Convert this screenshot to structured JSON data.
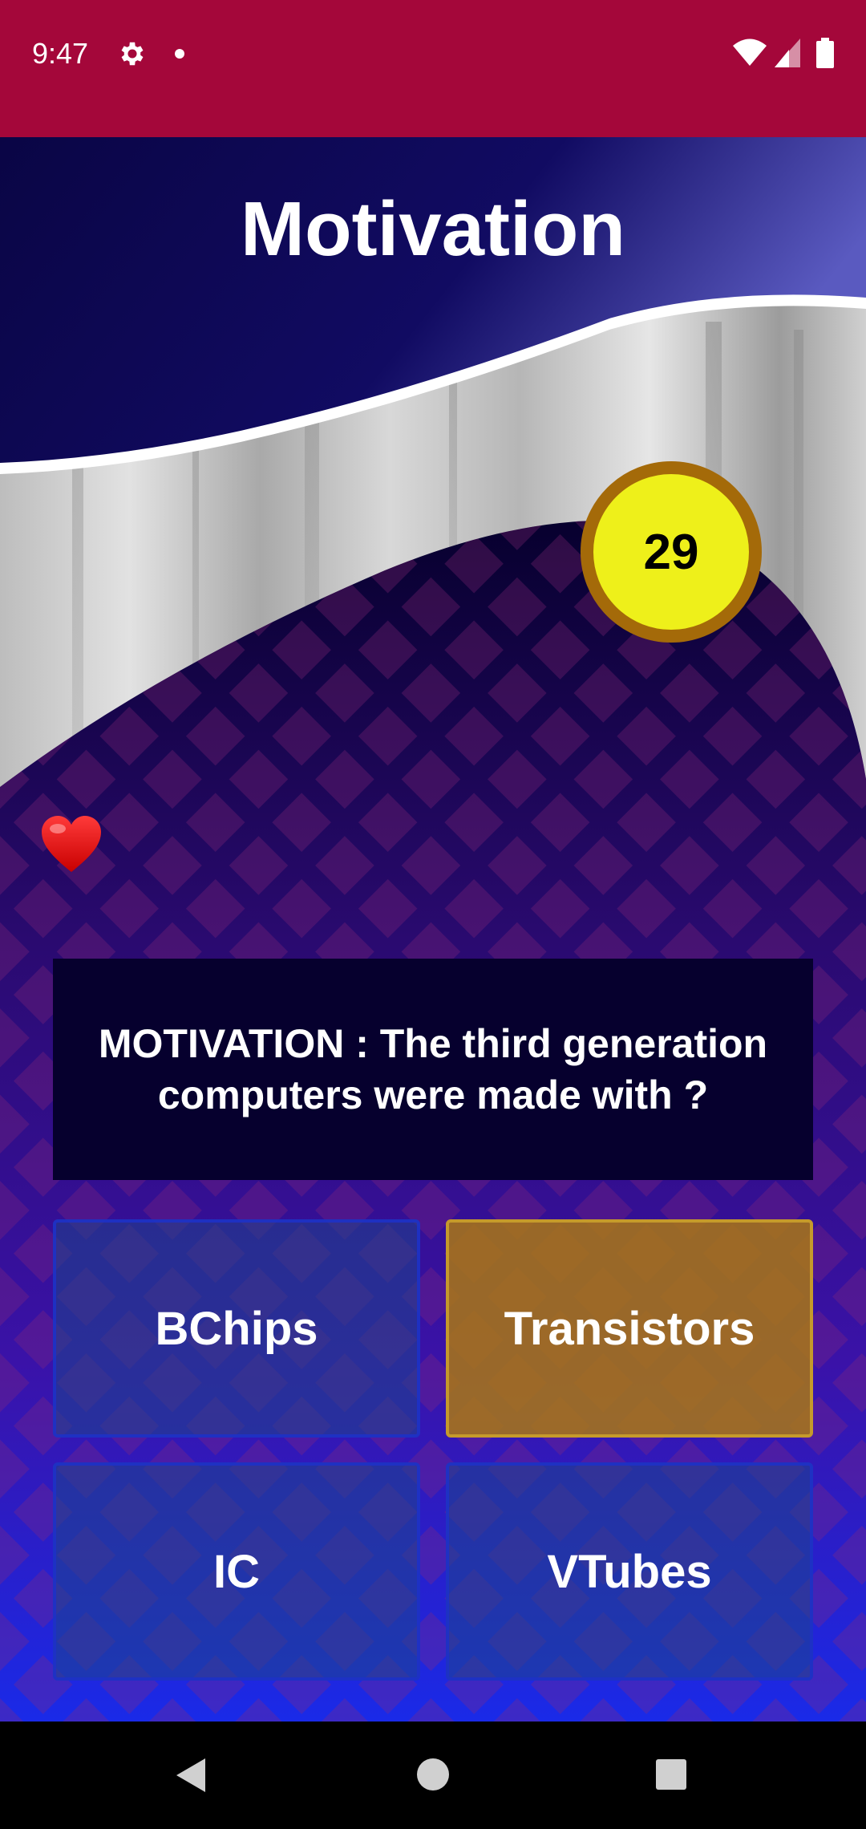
{
  "status_bar": {
    "time": "9:47",
    "icons": [
      "gear-icon",
      "notification-dot-icon",
      "wifi-icon",
      "signal-icon",
      "battery-icon"
    ],
    "background": "#a4073a"
  },
  "game": {
    "title": "Motivation",
    "timer": "29",
    "lives_icon": "heart-icon",
    "question": "MOTIVATION : The third generation computers were made with ?",
    "answers": [
      {
        "label": "BChips",
        "selected": false
      },
      {
        "label": "Transistors",
        "selected": true
      },
      {
        "label": "IC",
        "selected": false
      },
      {
        "label": "VTubes",
        "selected": false
      }
    ],
    "colors": {
      "header": "#0e0a5a",
      "timer_fill": "#eef01a",
      "timer_ring": "#a46a09",
      "question_bg": "#06002e",
      "selected_answer": "#aa7814"
    }
  },
  "nav_bar": {
    "icons": [
      "back-icon",
      "home-icon",
      "recents-icon"
    ]
  }
}
